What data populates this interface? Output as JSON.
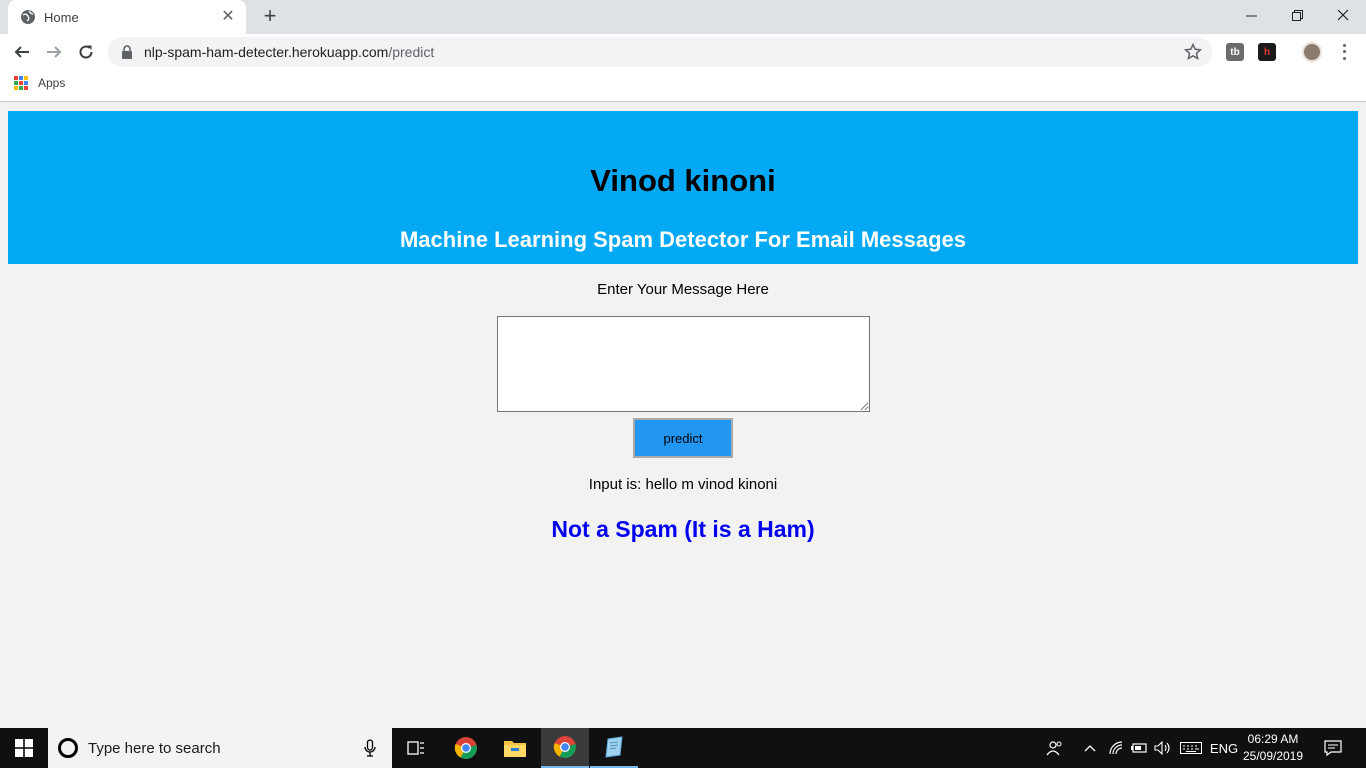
{
  "browser": {
    "tab_title": "Home",
    "url_host": "nlp-spam-ham-detecter.herokuapp.com",
    "url_path": "/predict",
    "bookmarks": {
      "apps_label": "Apps"
    },
    "extensions": [
      "tb",
      "h"
    ]
  },
  "page": {
    "heading": "Vinod kinoni",
    "subheading": "Machine Learning Spam Detector For Email Messages",
    "prompt": "Enter Your Message Here",
    "message_value": "",
    "predict_label": "predict",
    "input_echo": "Input is: hello m vinod kinoni",
    "result": "Not a Spam (It is a Ham)"
  },
  "taskbar": {
    "search_placeholder": "Type here to search",
    "language": "ENG",
    "time": "06:29 AM",
    "date": "25/09/2019",
    "pinned": [
      "chrome-icon",
      "file-explorer-icon",
      "chrome-icon",
      "notepad-icon"
    ]
  },
  "colors": {
    "hero": "#03a9f4",
    "button": "#2196f3",
    "result": "#0000ee",
    "page_bg": "#f2f2f2"
  }
}
